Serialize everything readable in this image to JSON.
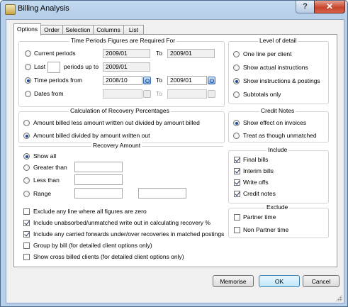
{
  "window": {
    "title": "Billing Analysis",
    "help": "?",
    "close": "✕"
  },
  "tabs": [
    "Options",
    "Order",
    "Selection",
    "Columns",
    "List"
  ],
  "time_periods": {
    "title": "Time Periods Figures are Required For",
    "current_label": "Current periods",
    "current_from": "2009/01",
    "current_to_label": "To",
    "current_to": "2009/01",
    "last_label": "Last",
    "last_value": "",
    "periods_up_to_label": "periods up to",
    "periods_up_to": "2009/01",
    "time_from_label": "Time periods from",
    "time_from": "2008/10",
    "time_to_label": "To",
    "time_to": "2009/01",
    "dates_from_label": "Dates from",
    "dates_from": "",
    "dates_to_label": "To",
    "dates_to": "",
    "selected": "time_from"
  },
  "level_of_detail": {
    "title": "Level of detail",
    "items": [
      "One line per client",
      "Show actual instructions",
      "Show instructions & postings",
      "Subtotals only"
    ],
    "selected": 2
  },
  "recovery": {
    "title": "Calculation of Recovery Percentages",
    "opt1": "Amount billed less amount written out divided by amount billed",
    "opt2": "Amount billed divided by amount written out",
    "selected": 1
  },
  "recovery_amount": {
    "title": "Recovery Amount",
    "show_all": "Show all",
    "greater": "Greater than",
    "less": "Less than",
    "range": "Range",
    "selected": 0
  },
  "credit_notes": {
    "title": "Credit Notes",
    "items": [
      "Show effect on invoices",
      "Treat as though unmatched"
    ],
    "selected": 0
  },
  "include": {
    "title": "Include",
    "items": [
      {
        "label": "Final bills",
        "checked": true
      },
      {
        "label": "Interim bills",
        "checked": true
      },
      {
        "label": "Write offs",
        "checked": true
      },
      {
        "label": "Credit notes",
        "checked": true
      }
    ]
  },
  "exclude": {
    "title": "Exclude",
    "items": [
      {
        "label": "Partner time",
        "checked": false
      },
      {
        "label": "Non Partner time",
        "checked": false
      }
    ]
  },
  "options": [
    {
      "label": "Exclude any line where all figures are zero",
      "checked": false
    },
    {
      "label": "Include unabsorbed/unmatched write out in calculating recovery %",
      "checked": true
    },
    {
      "label": "Include any carried forwards under/over recoveries in matched postings",
      "checked": true
    },
    {
      "label": "Group by bill (for detailed client options only)",
      "checked": false
    },
    {
      "label": "Show cross billed clients (for detailed client options only)",
      "checked": false
    }
  ],
  "buttons": {
    "memorise": "Memorise",
    "ok": "OK",
    "cancel": "Cancel"
  }
}
